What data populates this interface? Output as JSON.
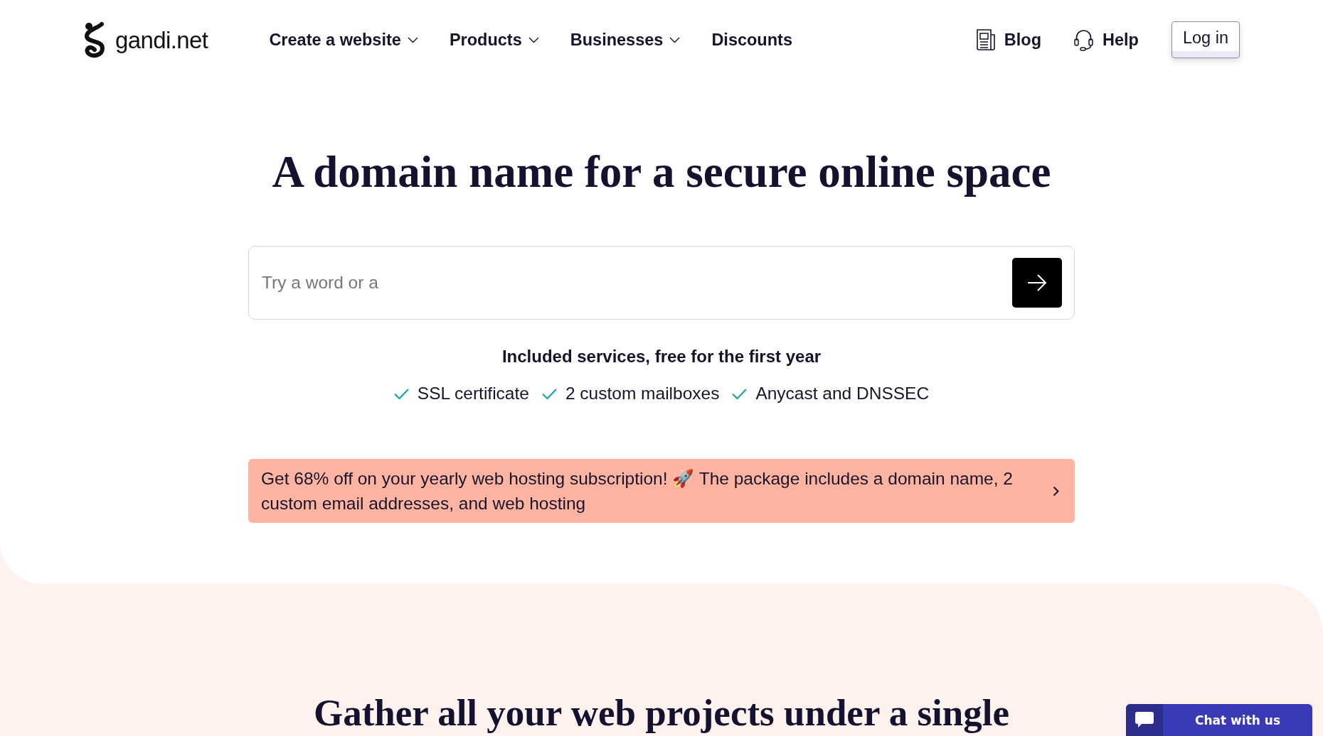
{
  "header": {
    "logo": {
      "text": "gandi.net"
    },
    "nav": [
      {
        "label": "Create a website",
        "kind": "menu"
      },
      {
        "label": "Products",
        "kind": "menu"
      },
      {
        "label": "Businesses",
        "kind": "menu"
      },
      {
        "label": "Discounts",
        "kind": "link"
      }
    ],
    "blog_link": {
      "label": "Blog"
    },
    "help_link": {
      "label": "Help"
    },
    "login_button": {
      "label": "Log in"
    }
  },
  "hero": {
    "title": "A domain name for a secure online space",
    "search": {
      "placeholder": "Try a word or a"
    },
    "included": {
      "title": "Included services, free for the first year",
      "items": [
        "SSL certificate",
        "2 custom mailboxes",
        "Anycast and DNSSEC"
      ]
    },
    "promo": {
      "text": "Get 68% off on your yearly web hosting subscription! 🚀 The package includes a domain name, 2 custom email addresses, and web hosting"
    }
  },
  "section": {
    "title": "Gather all your web projects under a single"
  },
  "chat": {
    "label": "Chat with us"
  }
}
